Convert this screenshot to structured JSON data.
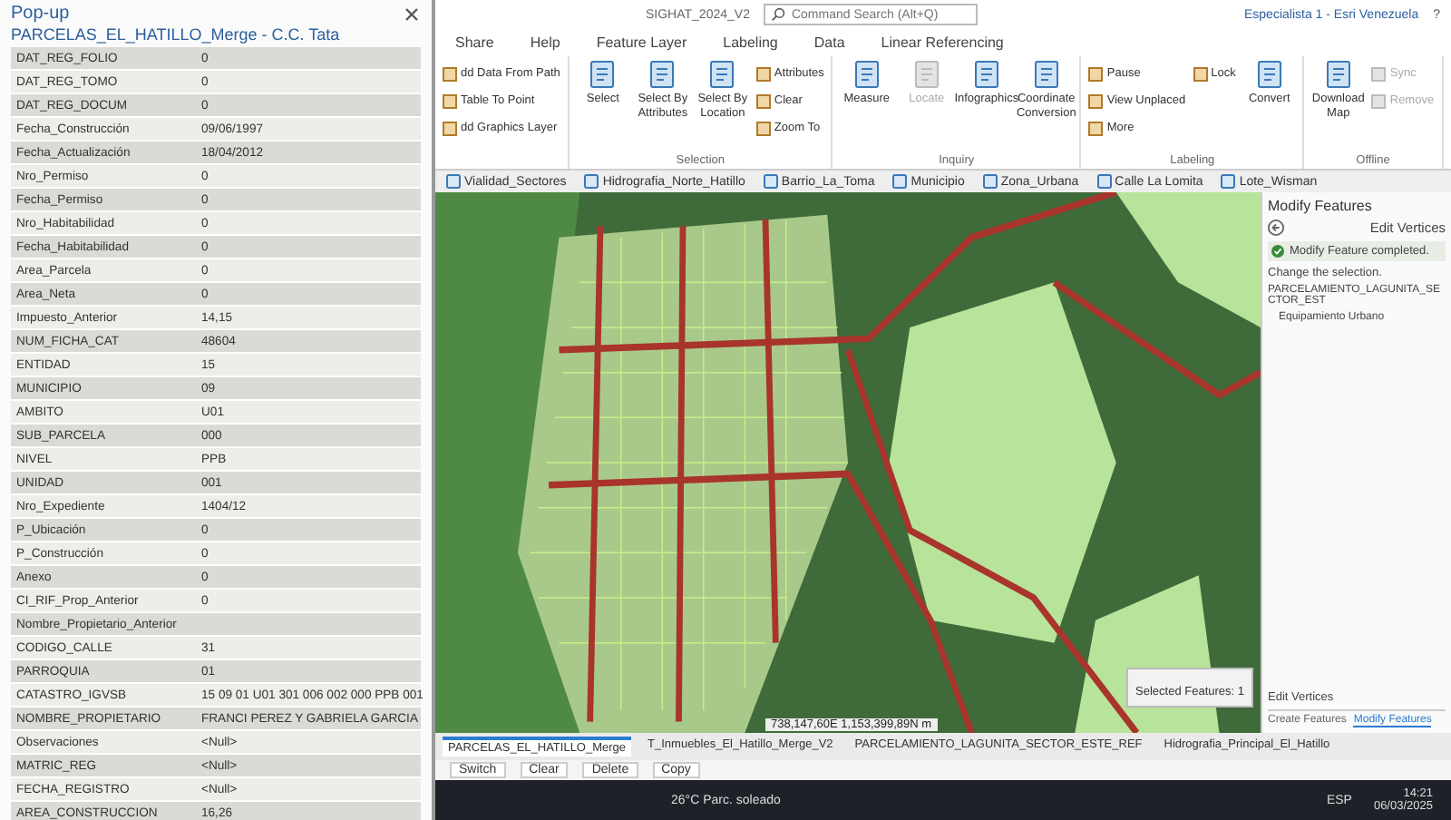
{
  "popup": {
    "window_title": "Pop-up",
    "layer_title": "PARCELAS_EL_HATILLO_Merge - C.C. Tata",
    "rows": [
      {
        "field": "DAT_REG_FOLIO",
        "value": "0"
      },
      {
        "field": "DAT_REG_TOMO",
        "value": "0"
      },
      {
        "field": "DAT_REG_DOCUM",
        "value": "0"
      },
      {
        "field": "Fecha_Construcción",
        "value": "09/06/1997"
      },
      {
        "field": "Fecha_Actualización",
        "value": "18/04/2012"
      },
      {
        "field": "Nro_Permiso",
        "value": "0"
      },
      {
        "field": "Fecha_Permiso",
        "value": "0"
      },
      {
        "field": "Nro_Habitabilidad",
        "value": "0"
      },
      {
        "field": "Fecha_Habitabilidad",
        "value": "0"
      },
      {
        "field": "Area_Parcela",
        "value": "0"
      },
      {
        "field": "Area_Neta",
        "value": "0"
      },
      {
        "field": "Impuesto_Anterior",
        "value": "14,15"
      },
      {
        "field": "NUM_FICHA_CAT",
        "value": "48604"
      },
      {
        "field": "ENTIDAD",
        "value": "15"
      },
      {
        "field": "MUNICIPIO",
        "value": "09"
      },
      {
        "field": "AMBITO",
        "value": "U01"
      },
      {
        "field": "SUB_PARCELA",
        "value": "000"
      },
      {
        "field": "NIVEL",
        "value": "PPB"
      },
      {
        "field": "UNIDAD",
        "value": "001"
      },
      {
        "field": "Nro_Expediente",
        "value": "1404/12"
      },
      {
        "field": "P_Ubicación",
        "value": "0"
      },
      {
        "field": "P_Construcción",
        "value": "0"
      },
      {
        "field": "Anexo",
        "value": "0"
      },
      {
        "field": "CI_RIF_Prop_Anterior",
        "value": "0"
      },
      {
        "field": "Nombre_Propietario_Anterior"
      },
      {
        "field": "CODIGO_CALLE",
        "value": "31"
      },
      {
        "field": "PARROQUIA",
        "value": "01"
      },
      {
        "field": "CATASTRO_IGVSB",
        "value": "15 09 01 U01 301 006 002 000 PPB 001"
      },
      {
        "field": "NOMBRE_PROPIETARIO",
        "value": "FRANCI PEREZ Y GABRIELA GARCIA"
      },
      {
        "field": "Observaciones",
        "value": "<Null>"
      },
      {
        "field": "MATRIC_REG",
        "value": "<Null>"
      },
      {
        "field": "FECHA_REGISTRO",
        "value": "<Null>"
      },
      {
        "field": "AREA_CONSTRUCCION",
        "value": "16,26"
      }
    ]
  },
  "app": {
    "project": "SIGHAT_2024_V2",
    "search": {
      "placeholder": "Command Search (Alt+Q)"
    },
    "user": "Especialista 1 - Esri Venezuela",
    "help": "?"
  },
  "ribbon_tabs": [
    {
      "label": "Share",
      "selected": false
    },
    {
      "label": "Help",
      "selected": false
    },
    {
      "label": "Feature Layer",
      "selected": false
    },
    {
      "label": "Labeling",
      "selected": false
    },
    {
      "label": "Data",
      "selected": false
    },
    {
      "label": "Linear Referencing",
      "selected": false
    }
  ],
  "ribbon_groups": [
    {
      "buttons": [
        {
          "label": "dd Data From Path",
          "kind": "small",
          "disabled": false
        },
        {
          "label": "Table To Point",
          "kind": "small",
          "disabled": false
        },
        {
          "label": "dd Graphics Layer",
          "kind": "small",
          "disabled": false
        }
      ]
    },
    {
      "label": "Selection",
      "buttons": [
        {
          "label": "Select",
          "kind": "large",
          "disabled": false
        },
        {
          "label": "Select By Attributes",
          "kind": "large",
          "disabled": false
        },
        {
          "label": "Select By Location",
          "kind": "large",
          "disabled": false
        },
        {
          "label": "Attributes",
          "kind": "small",
          "disabled": false
        },
        {
          "label": "Clear",
          "kind": "small",
          "disabled": false
        },
        {
          "label": "Zoom To",
          "kind": "small",
          "disabled": false
        }
      ]
    },
    {
      "label": "Inquiry",
      "buttons": [
        {
          "label": "Measure",
          "kind": "large",
          "disabled": false
        },
        {
          "label": "Locate",
          "kind": "large",
          "disabled": true
        },
        {
          "label": "Infographics",
          "kind": "large",
          "disabled": false
        },
        {
          "label": "Coordinate Conversion",
          "kind": "large",
          "disabled": false
        }
      ]
    },
    {
      "label": "Labeling",
      "buttons": [
        {
          "label": "Pause",
          "kind": "small",
          "disabled": false
        },
        {
          "label": "View Unplaced",
          "kind": "small",
          "disabled": false
        },
        {
          "label": "More",
          "kind": "small",
          "disabled": false
        },
        {
          "label": "Lock",
          "kind": "small",
          "disabled": false
        },
        {
          "label": "Convert",
          "kind": "large",
          "disabled": false
        }
      ]
    },
    {
      "label": "Offline",
      "buttons": [
        {
          "label": "Download Map",
          "kind": "large",
          "disabled": false
        },
        {
          "label": "Sync",
          "kind": "small",
          "disabled": true
        },
        {
          "label": "Remove",
          "kind": "small",
          "disabled": true
        }
      ]
    }
  ],
  "layer_tabs": [
    "Vialidad_Sectores",
    "Hidrografia_Norte_Hatillo",
    "Barrio_La_Toma",
    "Municipio",
    "Zona_Urbana",
    "Calle La Lomita",
    "Lote_Wisman"
  ],
  "modify_pane": {
    "title": "Modify Features",
    "tool": "Edit Vertices",
    "message": "Modify Feature completed.",
    "hint": "Change the selection.",
    "feature": "PARCELAMIENTO_LAGUNITA_SECTOR_EST",
    "feature_type": "Equipamiento Urbano",
    "action": "Edit Vertices",
    "tabs": [
      {
        "label": "Create Features",
        "selected": false
      },
      {
        "label": "Modify Features",
        "selected": true
      }
    ]
  },
  "map": {
    "selected_features": "Selected Features: 1",
    "coordinates": "738,147,60E 1,153,399,89N m"
  },
  "table_tabs": [
    {
      "label": "PARCELAS_EL_HATILLO_Merge",
      "selected": true
    },
    {
      "label": "T_Inmuebles_El_Hatillo_Merge_V2",
      "selected": false
    },
    {
      "label": "PARCELAMIENTO_LAGUNITA_SECTOR_ESTE_REF",
      "selected": false
    },
    {
      "label": "Hidrografia_Principal_El_Hatillo",
      "selected": false
    }
  ],
  "table_actions": [
    "Switch",
    "Clear",
    "Delete",
    "Copy"
  ],
  "taskbar": {
    "weather": "26°C  Parc. soleado",
    "language": "ESP",
    "time": "14:21",
    "date": "06/03/2025"
  }
}
